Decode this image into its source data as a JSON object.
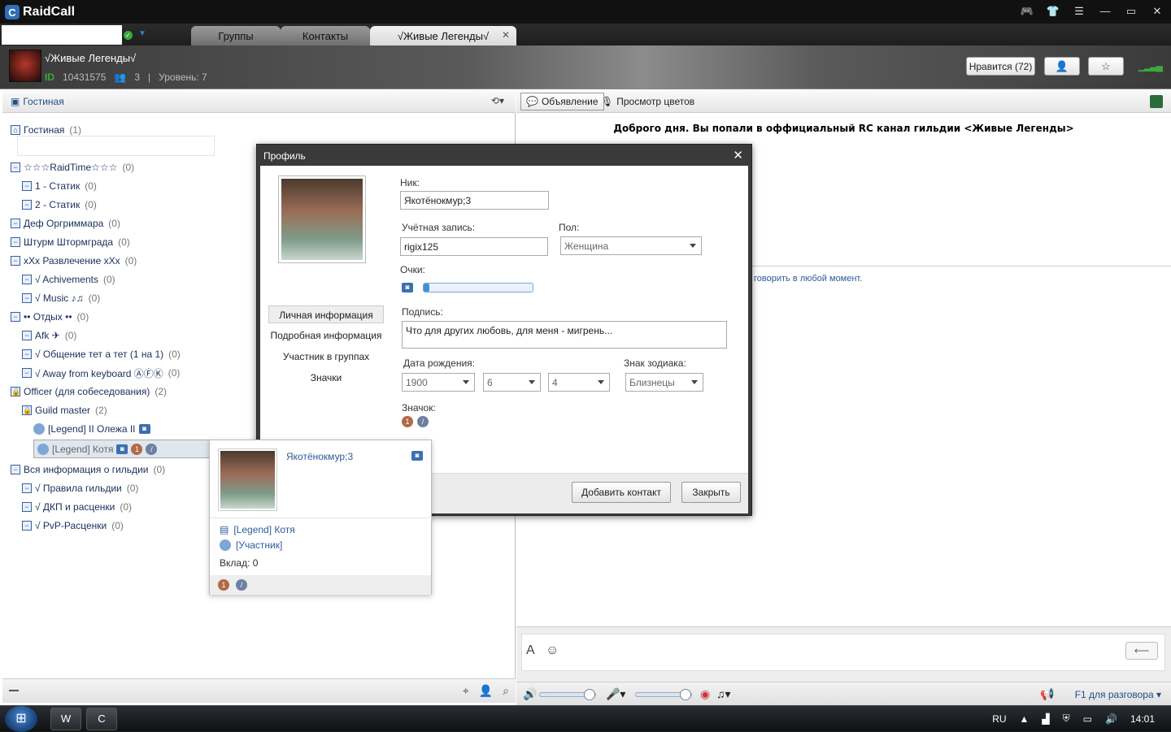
{
  "app": {
    "title": "RaidCall"
  },
  "window_controls": {
    "gamepad": "🎮",
    "shirt": "👕",
    "list": "☰",
    "minimize": "—",
    "maximize": "▭",
    "close": "✕"
  },
  "tabs": [
    {
      "label": "Группы"
    },
    {
      "label": "Контакты"
    },
    {
      "label": "√Живые Легенды√",
      "active": true
    }
  ],
  "group": {
    "name": "√Живые Легенды√",
    "id_label": "ID",
    "id": "10431575",
    "members": "3",
    "level": "Уровень: 7",
    "like_label": "Нравится (72)"
  },
  "left": {
    "lobby_tab": "Гостиная",
    "tree": [
      {
        "label": "Гостиная",
        "count": "(1)",
        "level": 0,
        "icon": "home-icon"
      },
      {
        "label": "☆☆☆RaidTime☆☆☆",
        "count": "(0)",
        "level": 0
      },
      {
        "label": "1 - Статик",
        "count": "(0)",
        "level": 1
      },
      {
        "label": "2 - Статик",
        "count": "(0)",
        "level": 1
      },
      {
        "label": "Деф Оргриммара",
        "count": "(0)",
        "level": 0
      },
      {
        "label": "Штурм Штормграда",
        "count": "(0)",
        "level": 0
      },
      {
        "label": "xXx Развлечение xXx",
        "count": "(0)",
        "level": 0
      },
      {
        "label": "√ Achivements",
        "count": "(0)",
        "level": 1
      },
      {
        "label": "√ Music ♪♫",
        "count": "(0)",
        "level": 1
      },
      {
        "label": "•• Отдых ••",
        "count": "(0)",
        "level": 0
      },
      {
        "label": "Afk ✈",
        "count": "(0)",
        "level": 1
      },
      {
        "label": "√ Общение тет а тет (1 на 1)",
        "count": "(0)",
        "level": 1
      },
      {
        "label": "√ Away from keyboard ⒶⒻⓀ",
        "count": "(0)",
        "level": 1
      },
      {
        "label": "Officer (для собеседования)",
        "count": "(2)",
        "level": 0,
        "locked": true
      },
      {
        "label": "Guild master",
        "count": "(2)",
        "level": 1,
        "locked": true
      },
      {
        "label": "[Legend] II Олежа II",
        "count": "",
        "level": 2,
        "user": true
      },
      {
        "label": "[Legend] Котя",
        "count": "",
        "level": 2,
        "user": true,
        "selected": true
      },
      {
        "label": "Вся информация о гильдии",
        "count": "(0)",
        "level": 0
      },
      {
        "label": "√ Правила гильдии",
        "count": "(0)",
        "level": 1
      },
      {
        "label": "√ ДКП и расценки",
        "count": "(0)",
        "level": 1
      },
      {
        "label": "√ PvP-Расценки",
        "count": "(0)",
        "level": 1
      }
    ]
  },
  "right": {
    "announcement_tab": "Объявление",
    "colors_button": "Просмотр цветов",
    "announcement": "Доброго дня. Вы попали в оффициальный RC канал гильдии <Живые Легенды>",
    "chat_note": "говорить в любой момент.",
    "ptt": "F1 для разговора"
  },
  "profile": {
    "title": "Профиль",
    "nav": [
      "Личная информация",
      "Подробная информация",
      "Участник в группах",
      "Значки"
    ],
    "nick_label": "Ник:",
    "nick": "Якотёнокмур;3",
    "account_label": "Учётная запись:",
    "account": "rigix125",
    "gender_label": "Пол:",
    "gender": "Женщина",
    "points_label": "Очки:",
    "points_fraction": 0.05,
    "signature_label": "Подпись:",
    "signature": "Что для других любовь, для меня - мигрень...",
    "birthday_label": "Дата рождения:",
    "birth_year": "1900",
    "birth_month": "6",
    "birth_day": "4",
    "zodiac_label": "Знак зодиака:",
    "zodiac": "Близнецы",
    "badge_label": "Значок:",
    "add_contact": "Добавить контакт",
    "close": "Закрыть"
  },
  "card": {
    "nick": "Якотёнокмур;3",
    "name": "[Legend] Котя",
    "role": "[Участник]",
    "contribution": "Вклад: 0"
  },
  "taskbar": {
    "lang": "RU",
    "time": "14:01"
  }
}
